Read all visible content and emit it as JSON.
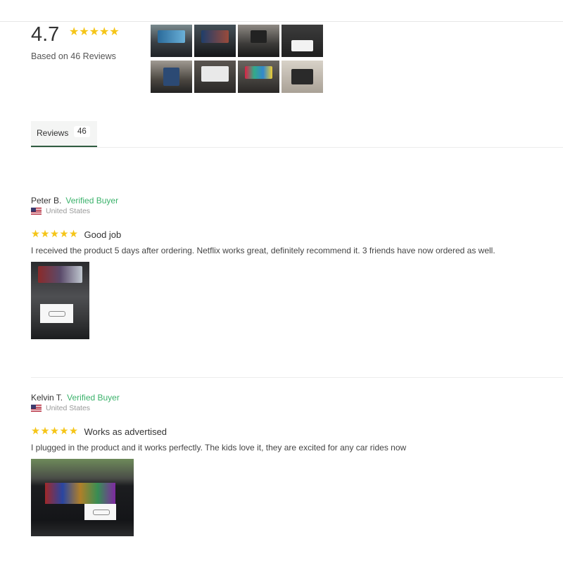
{
  "summary": {
    "average": "4.7",
    "stars": "★★★★★",
    "based_on": "Based on 46 Reviews"
  },
  "gallery": {
    "photos": [
      "review-photo",
      "review-photo",
      "review-photo",
      "review-photo",
      "review-photo",
      "review-photo",
      "review-photo",
      "review-photo"
    ]
  },
  "tabs": [
    {
      "label": "Reviews",
      "count": "46"
    }
  ],
  "reviews": [
    {
      "name": "Peter B.",
      "verified": "Verified Buyer",
      "country": "United States",
      "stars": "★★★★★",
      "title": "Good job",
      "body": "I received the product 5 days after ordering. Netflix works great, definitely recommend it. 3 friends have now ordered as well."
    },
    {
      "name": "Kelvin T.",
      "verified": "Verified Buyer",
      "country": "United States",
      "stars": "★★★★★",
      "title": "Works as advertised",
      "body": "I plugged in the product and it works perfectly. The kids love it, they are excited for any car rides now"
    }
  ],
  "colors": {
    "star": "#f5c518",
    "verified": "#3bb26b",
    "tab_underline": "#2f5c40"
  }
}
